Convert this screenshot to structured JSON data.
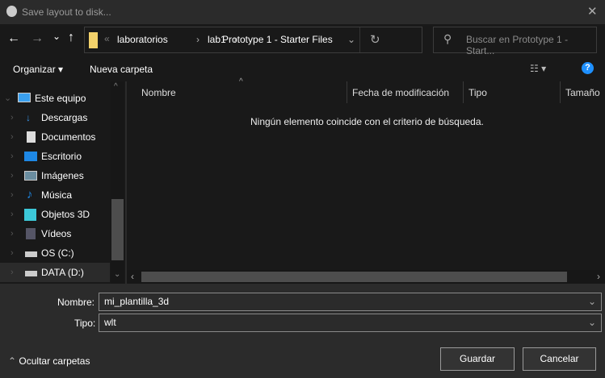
{
  "window": {
    "title": "Save layout to disk...",
    "close": "✕"
  },
  "nav": {
    "back": "←",
    "forward": "→",
    "recent": "⌄",
    "up": "↑",
    "breadcrumb": [
      "laboratorios",
      "lab1",
      "Prototype 1 - Starter Files"
    ],
    "overflow": "«",
    "refresh": "↻",
    "search_placeholder": "Buscar en Prototype 1 - Start..."
  },
  "toolbar": {
    "organize": "Organizar",
    "new_folder": "Nueva carpeta",
    "help": "?"
  },
  "columns": [
    "Nombre",
    "Fecha de modificación",
    "Tipo",
    "Tamaño"
  ],
  "empty_message": "Ningún elemento coincide con el criterio de búsqueda.",
  "sidebar": {
    "root": "Este equipo",
    "items": [
      {
        "label": "Descargas",
        "icon": "download-icon"
      },
      {
        "label": "Documentos",
        "icon": "document-icon"
      },
      {
        "label": "Escritorio",
        "icon": "desktop-icon"
      },
      {
        "label": "Imágenes",
        "icon": "image-icon"
      },
      {
        "label": "Música",
        "icon": "music-icon"
      },
      {
        "label": "Objetos 3D",
        "icon": "cube-icon"
      },
      {
        "label": "Vídeos",
        "icon": "video-icon"
      },
      {
        "label": "OS (C:)",
        "icon": "drive-icon"
      },
      {
        "label": "DATA (D:)",
        "icon": "drive-icon"
      }
    ]
  },
  "form": {
    "name_label": "Nombre:",
    "name_value": "mi_plantilla_3d",
    "type_label": "Tipo:",
    "type_value": "wlt"
  },
  "footer": {
    "hide_folders": "Ocultar carpetas",
    "save": "Guardar",
    "cancel": "Cancelar"
  },
  "colors": {
    "accent": "#1e90ff",
    "folder": "#f3d26b"
  }
}
